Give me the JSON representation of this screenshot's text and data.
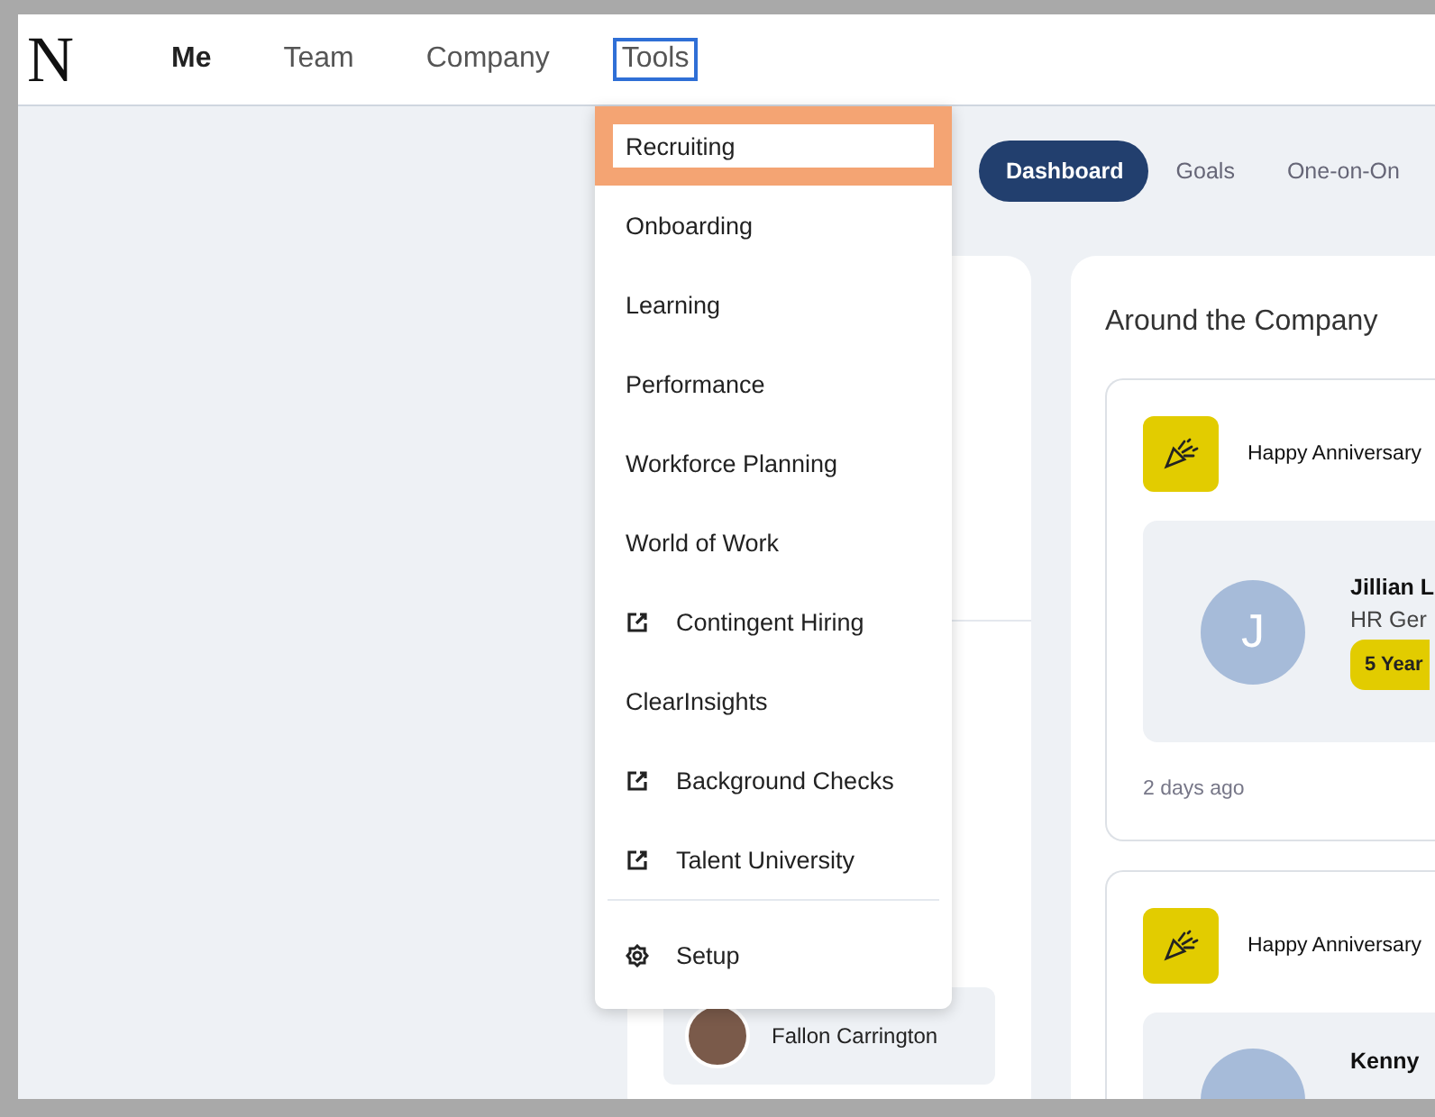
{
  "nav": {
    "logo": "N",
    "items": [
      {
        "label": "Me",
        "selected": true,
        "expanded": false
      },
      {
        "label": "Team",
        "selected": false,
        "expanded": false
      },
      {
        "label": "Company",
        "selected": false,
        "expanded": false
      },
      {
        "label": "Tools",
        "selected": false,
        "expanded": true
      }
    ]
  },
  "tools_menu": [
    {
      "label": "Recruiting",
      "kind": "link",
      "selected": true
    },
    {
      "label": "Onboarding",
      "kind": "link",
      "selected": false
    },
    {
      "label": "Learning",
      "kind": "link",
      "selected": false
    },
    {
      "label": "Performance",
      "kind": "link",
      "selected": false
    },
    {
      "label": "Workforce Planning",
      "kind": "link",
      "selected": false
    },
    {
      "label": "World of Work",
      "kind": "link",
      "selected": false
    },
    {
      "label": "Contingent Hiring",
      "kind": "external",
      "selected": false
    },
    {
      "label": "ClearInsights",
      "kind": "link",
      "selected": false
    },
    {
      "label": "Background Checks",
      "kind": "external",
      "selected": false
    },
    {
      "label": "Talent University",
      "kind": "external",
      "selected": false
    },
    {
      "label": "Setup",
      "kind": "settings",
      "selected": false
    }
  ],
  "tabs": [
    {
      "label": "Dashboard",
      "selected": true
    },
    {
      "label": "Goals",
      "selected": false
    },
    {
      "label": "One-on-On",
      "selected": false
    }
  ],
  "left_card": {
    "people": [
      {
        "name": "Fallon Carrington"
      }
    ]
  },
  "around_the_company": {
    "title": "Around the Company",
    "events": [
      {
        "title": "Happy Anniversary",
        "person": {
          "initial": "J",
          "name": "Jillian L",
          "role": "HR Ger",
          "badge": "5 Year"
        },
        "time": "2 days ago"
      },
      {
        "title": "Happy Anniversary",
        "person": {
          "name": "Kenny"
        }
      }
    ]
  }
}
